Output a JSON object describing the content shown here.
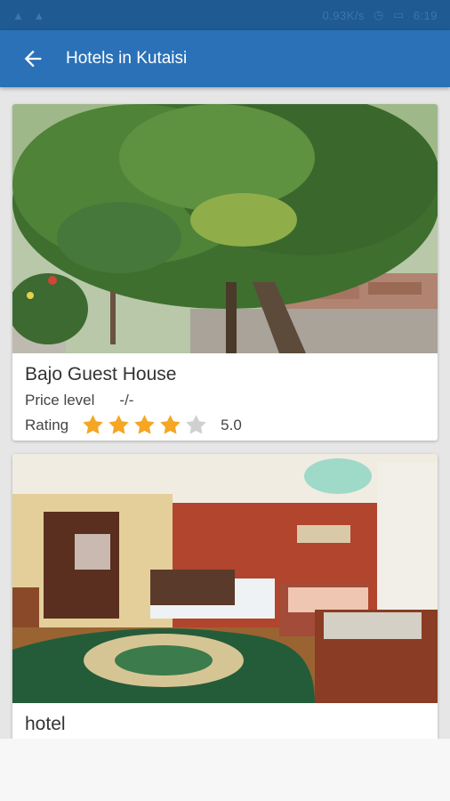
{
  "header": {
    "title": "Hotels in Kutaisi"
  },
  "statusbar": {
    "time": "6:19",
    "data_rate": "0.93K/s"
  },
  "hotels": [
    {
      "name": "Bajo Guest House",
      "price_label": "Price level",
      "price_value": "-/-",
      "rating_label": "Rating",
      "rating_value": "5.0",
      "stars_filled": 4,
      "stars_total": 5
    },
    {
      "name": "hotel"
    }
  ],
  "colors": {
    "appbar": "#2a71b8",
    "statusbar": "#1f5a92",
    "star_filled": "#f5a623",
    "star_empty": "#d0d0d0"
  }
}
